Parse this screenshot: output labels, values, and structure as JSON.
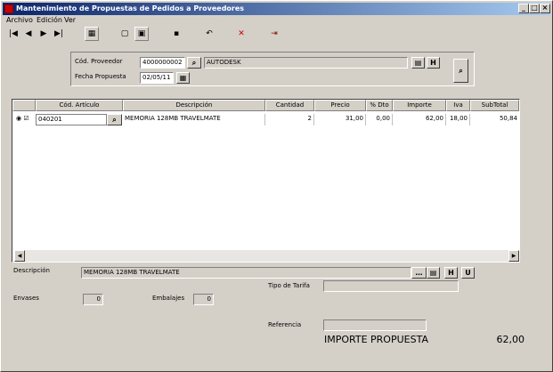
{
  "window": {
    "title": "Mantenimiento de Propuestas de Pedidos a Proveedores"
  },
  "menu": [
    "Archivo",
    "Edición",
    "Ver"
  ],
  "header": {
    "proveedor_label": "Cód. Proveedor",
    "proveedor_code": "4000000002",
    "proveedor_name": "AUTODESK",
    "fecha_label": "Fecha Propuesta",
    "fecha_value": "02/05/11"
  },
  "grid": {
    "columns": [
      "Cód. Artículo",
      "Descripción",
      "Cantidad",
      "Precio",
      "% Dto",
      "Importe",
      "Iva",
      "SubTotal"
    ],
    "rows": [
      {
        "codigo": "040201",
        "descripcion": "MEMORIA 128MB TRAVELMATE",
        "cantidad": "2",
        "precio": "31,00",
        "dto": "0,00",
        "importe": "62,00",
        "iva": "18,00",
        "subtotal": "50,84"
      }
    ]
  },
  "footer": {
    "descripcion_label": "Descripción",
    "descripcion_value": "MEMORIA 128MB TRAVELMATE",
    "tipo_tarifa_label": "Tipo de Tarifa",
    "tipo_tarifa_value": "",
    "envases_label": "Envases",
    "envases_value": "0",
    "embalajes_label": "Embalajes",
    "embalajes_value": "0",
    "referencia_label": "Referencia",
    "referencia_value": "",
    "importe_label": "IMPORTE PROPUESTA",
    "importe_value": "62,00"
  },
  "buttons": {
    "h": "H",
    "u": "U"
  }
}
